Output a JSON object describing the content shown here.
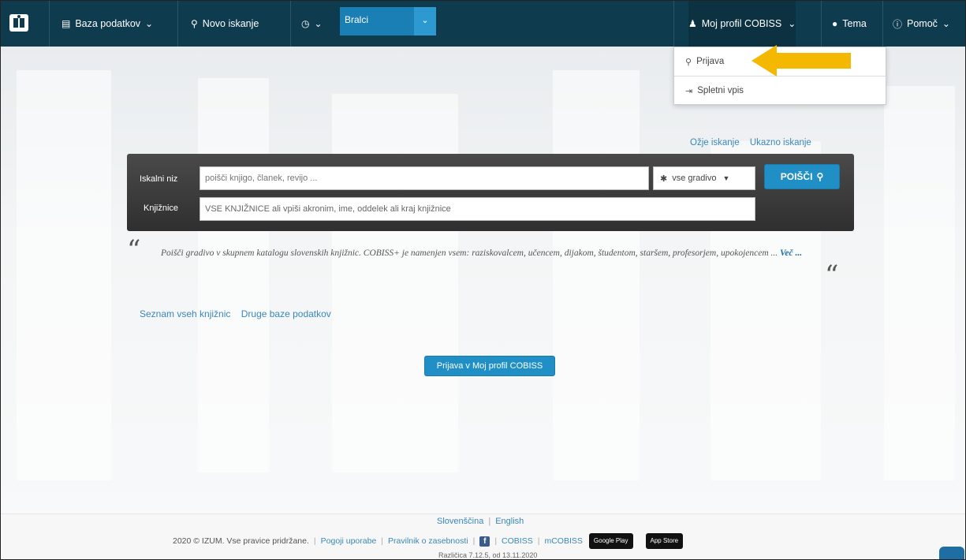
{
  "navbar": {
    "database_label": "Baza podatkov",
    "new_search_label": "Novo iskanje",
    "history_label": "",
    "library_select_value": "Bralci",
    "profile_label": "Moj profil COBISS",
    "theme_label": "Tema",
    "help_label": "Pomoč"
  },
  "profile_menu": {
    "items": [
      {
        "label": "Prijava",
        "icon": "key-icon"
      },
      {
        "label": "Spletni vpis",
        "icon": "sign-in-icon"
      }
    ]
  },
  "search": {
    "top_links": [
      "Ožje iskanje",
      "Ukazno iskanje"
    ],
    "query_label": "Iskalni niz",
    "query_placeholder": "poišči knjigo, članek, revijo ...",
    "library_label": "Knjižnice",
    "library_value": "VSE KNJIŽNICE ali vpiši akronim, ime, oddelek ali kraj knjižnice",
    "material_value": "vse gradivo",
    "submit_label": "POIŠČI"
  },
  "intro": {
    "text": "Poišči gradivo v skupnem katalogu slovenskih knjižnic. COBISS+ je namenjen vsem: raziskovalcem, učencem, dijakom, študentom, staršem, profesorjem, upokojencem ...",
    "more": "Več ..."
  },
  "links": [
    "Seznam vseh knjižnic",
    "Druge baze podatkov"
  ],
  "login_button": "Prijava v Moj profil COBISS",
  "footer": {
    "languages": [
      "Slovenščina",
      "English"
    ],
    "copyright": "2020 © IZUM. Vse pravice pridržane.",
    "links": [
      "Pogoji uporabe",
      "Pravilnik o zasebnosti"
    ],
    "cobiss": "COBISS",
    "mcobiss": "mCOBISS",
    "store_badges": [
      "Google Play",
      "App Store"
    ],
    "version": "Različica 7.12.5, od 13.11.2020"
  },
  "colors": {
    "navbar": "#0f3b4f",
    "accent": "#1f8fc6",
    "arrow": "#f5b800"
  }
}
